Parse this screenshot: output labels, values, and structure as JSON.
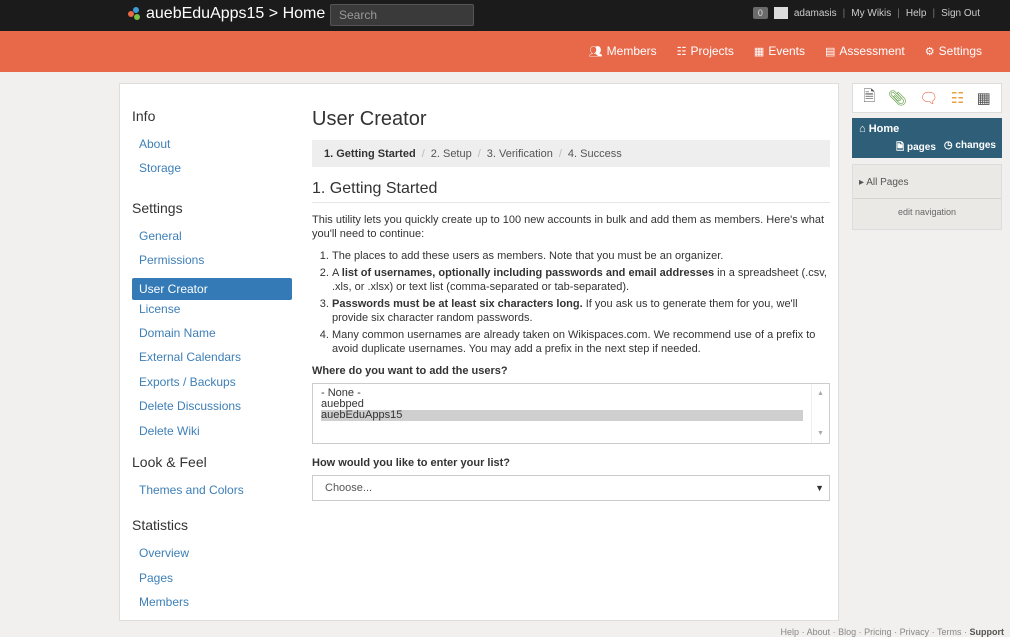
{
  "topbar": {
    "site_title": "auebEduApps15 > Home",
    "search_placeholder": "Search",
    "notification_count": "0",
    "username": "adamasis",
    "links": [
      "My Wikis",
      "Help",
      "Sign Out"
    ]
  },
  "nav": {
    "items": [
      {
        "icon": "members-icon",
        "label": "Members"
      },
      {
        "icon": "projects-icon",
        "label": "Projects"
      },
      {
        "icon": "calendar-icon",
        "label": "Events"
      },
      {
        "icon": "assessment-icon",
        "label": "Assessment"
      },
      {
        "icon": "gear-icon",
        "label": "Settings"
      }
    ]
  },
  "sidebar": {
    "groups": [
      {
        "title": "Info",
        "items": [
          "About",
          "Storage"
        ]
      },
      {
        "title": "Settings",
        "items": [
          "General",
          "Permissions",
          "User Creator",
          "License",
          "Domain Name",
          "External Calendars",
          "Exports / Backups",
          "Delete Discussions",
          "Delete Wiki"
        ]
      },
      {
        "title": "Look & Feel",
        "items": [
          "Themes and Colors"
        ]
      },
      {
        "title": "Statistics",
        "items": [
          "Overview",
          "Pages",
          "Members"
        ]
      }
    ],
    "active_item": "User Creator"
  },
  "content": {
    "page_title": "User Creator",
    "steps": [
      "1. Getting Started",
      "2. Setup",
      "3. Verification",
      "4. Success"
    ],
    "section_title": "1. Getting Started",
    "intro": "This utility lets you quickly create up to 100 new accounts in bulk and add them as members. Here's what you'll need to continue:",
    "requirements": [
      {
        "bold": "",
        "text": "The places to add these users as members. Note that you must be an organizer.",
        "pre": ""
      },
      {
        "pre": "A ",
        "bold": "list of usernames, optionally including passwords and email addresses",
        "text": " in a spreadsheet (.csv, .xls, or .xlsx) or text list (comma-separated or tab-separated)."
      },
      {
        "pre": "",
        "bold": "Passwords must be at least six characters long.",
        "text": " If you ask us to generate them for you, we'll provide six character random passwords."
      },
      {
        "pre": "",
        "bold": "",
        "text": "Many common usernames are already taken on Wikispaces.com. We recommend use of a prefix to avoid duplicate usernames. You may add a prefix in the next step if needed."
      }
    ],
    "where_label": "Where do you want to add the users?",
    "where_options": [
      "- None -",
      "auebped",
      "auebEduApps15"
    ],
    "where_selected": "auebEduApps15",
    "how_label": "How would you like to enter your list?",
    "how_selected": "Choose..."
  },
  "right": {
    "toolbar_icons": [
      "page-icon",
      "attachment-icon",
      "comment-icon",
      "hierarchy-icon",
      "calendar-icon"
    ],
    "home_title": "Home",
    "home_links": [
      "pages",
      "changes"
    ],
    "all_pages": "All Pages",
    "edit_navigation": "edit navigation"
  },
  "footer": {
    "links": [
      "Help",
      "About",
      "Blog",
      "Pricing",
      "Privacy",
      "Terms"
    ],
    "support": "Support"
  }
}
